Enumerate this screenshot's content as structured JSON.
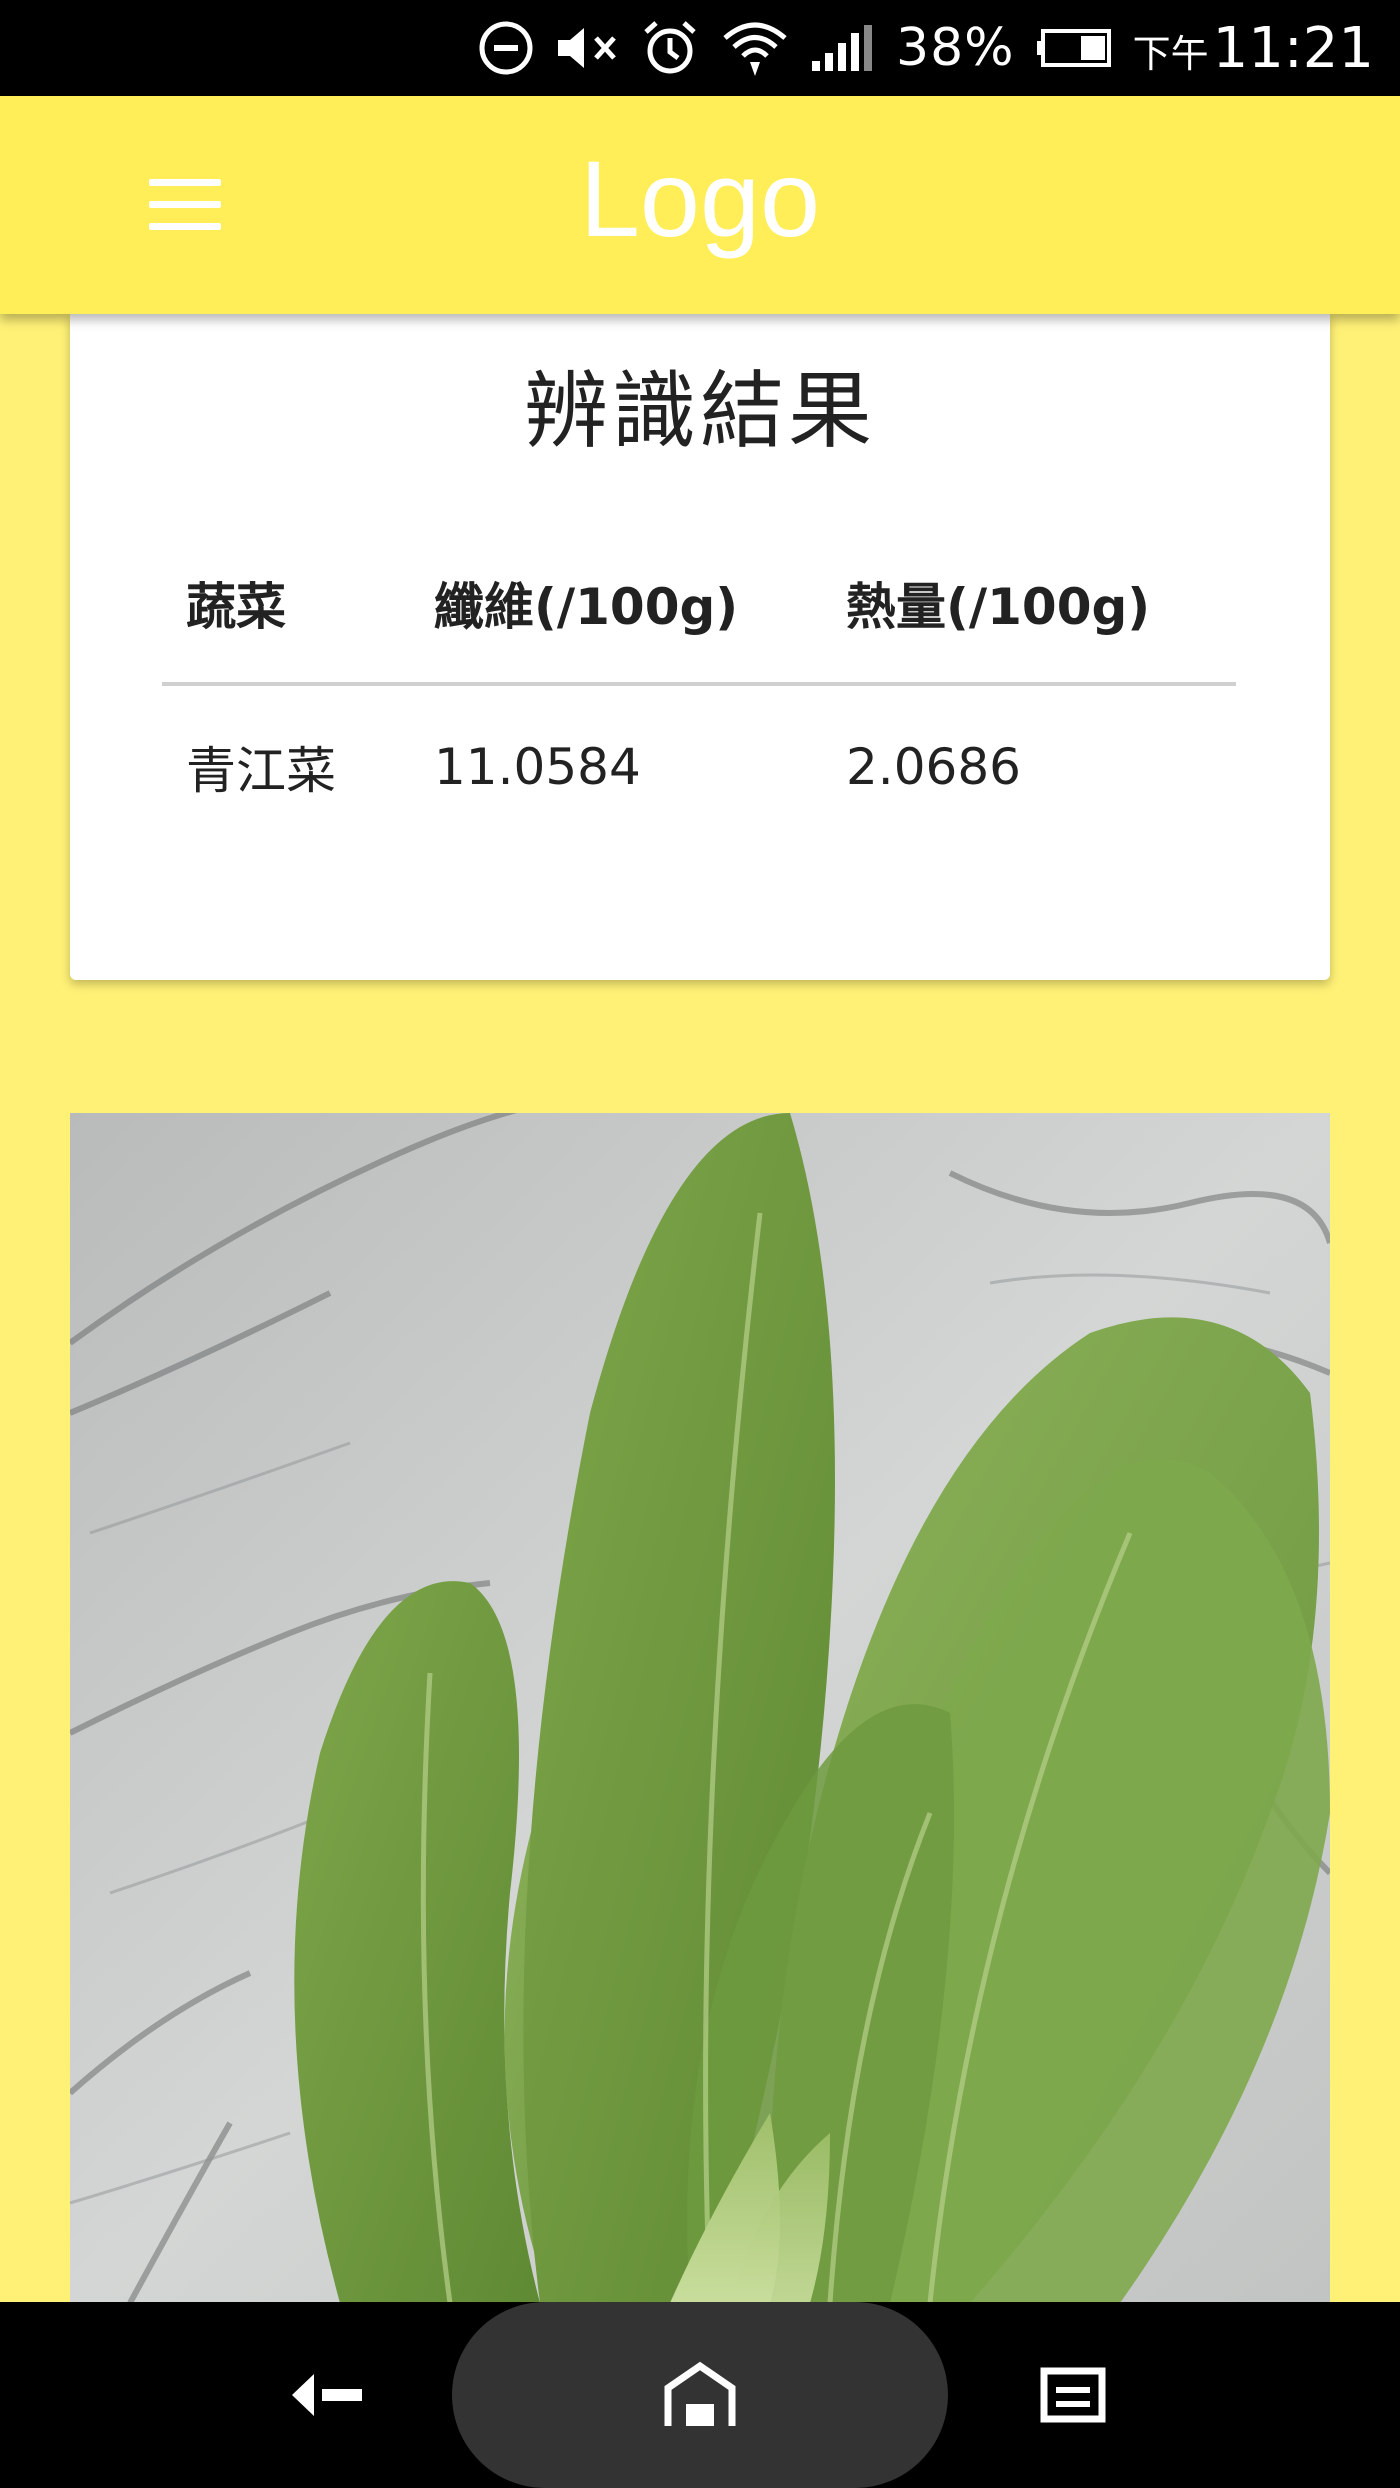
{
  "status_bar": {
    "battery_percent": "38%",
    "time_prefix": "下午",
    "time": "11:21",
    "icons": [
      "do-not-disturb-icon",
      "mute-icon",
      "alarm-icon",
      "wifi-icon",
      "signal-icon",
      "battery-icon"
    ]
  },
  "app_bar": {
    "logo": "Logo",
    "menu_icon": "hamburger-menu-icon"
  },
  "result": {
    "title": "辨識結果",
    "headers": [
      "蔬菜",
      "纖維(/100g)",
      "熱量(/100g)"
    ],
    "rows": [
      [
        "青江菜",
        "11.0584",
        "2.0686"
      ]
    ]
  },
  "photo": {
    "subject": "bok-choy-photo"
  },
  "nav_bar": {
    "icons": [
      "back-icon",
      "home-icon",
      "recents-icon"
    ]
  }
}
